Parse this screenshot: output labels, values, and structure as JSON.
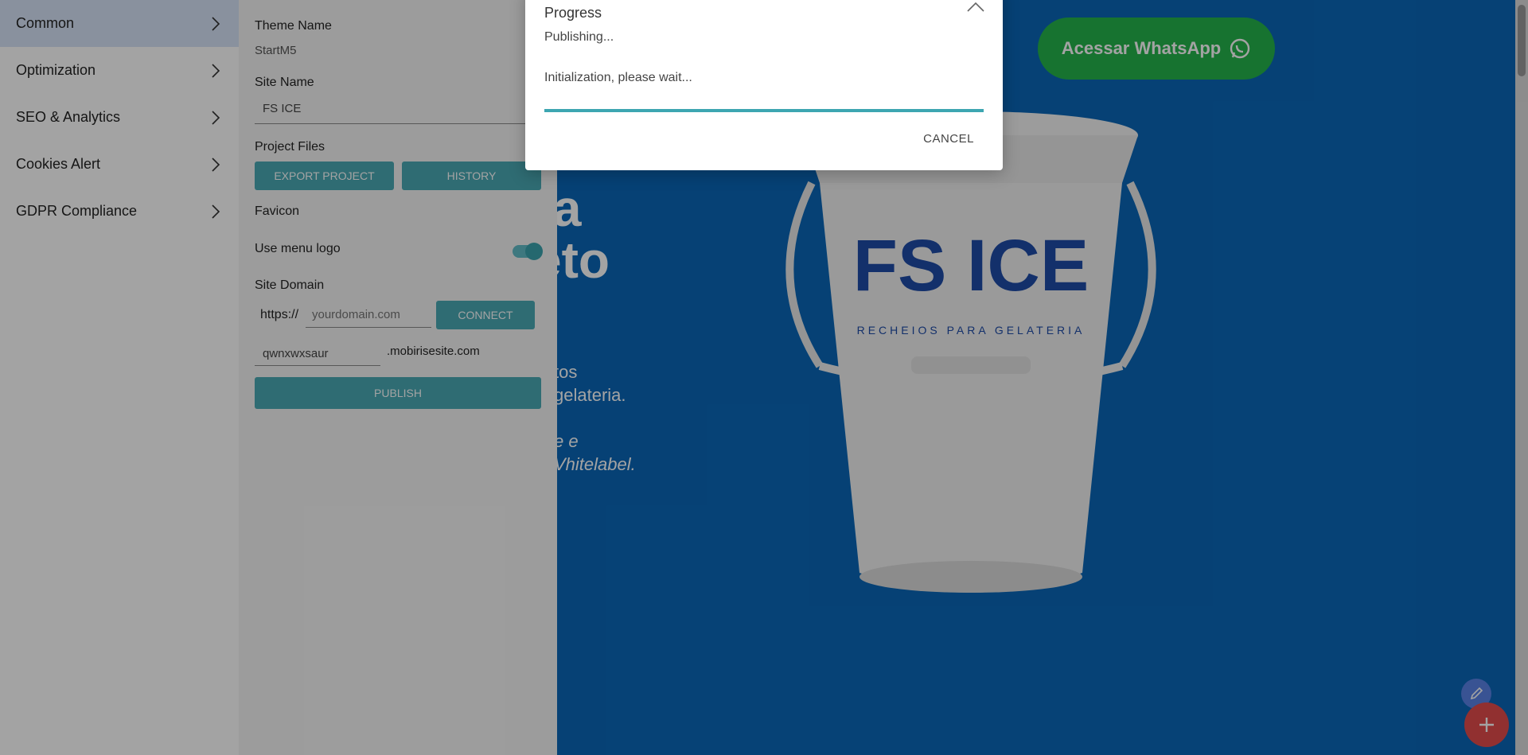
{
  "sidebar": {
    "items": [
      {
        "label": "Common"
      },
      {
        "label": "Optimization"
      },
      {
        "label": "SEO & Analytics"
      },
      {
        "label": "Cookies Alert"
      },
      {
        "label": "GDPR Compliance"
      }
    ]
  },
  "settings": {
    "theme_name_label": "Theme Name",
    "theme_name_value": "StartM5",
    "site_name_label": "Site Name",
    "site_name_value": "FS ICE",
    "project_files_label": "Project Files",
    "export_label": "EXPORT PROJECT",
    "history_label": "HISTORY",
    "favicon_label": "Favicon",
    "menu_logo_label": "Use menu logo",
    "menu_logo_on": true,
    "site_domain_label": "Site Domain",
    "https_prefix": "https://",
    "domain_placeholder": "yourdomain.com",
    "connect_label": "CONNECT",
    "subdomain_value": "qwnxwxsaur",
    "subdomain_suffix": ".mobirisesite.com",
    "publish_label": "PUBLISH"
  },
  "preview": {
    "whatsapp_label": "Acessar WhatsApp",
    "hero_line1": "ra",
    "hero_line2": "eto",
    "sub_line1": "tos",
    "sub_line2": "gelateria.",
    "sub_line3": "e e",
    "sub_line4": "Vhitelabel.",
    "bucket_brand": "FS ICE",
    "bucket_tagline": "RECHEIOS PARA GELATERIA"
  },
  "dialog": {
    "title": "Progress",
    "publishing": "Publishing...",
    "init": "Initialization, please wait...",
    "cancel_label": "CANCEL"
  },
  "colors": {
    "accent": "#4aa9b4",
    "preview_bg": "#0a67b8",
    "whatsapp": "#25b44c",
    "fab_add": "#e34b4b",
    "fab_edit": "#5a82e6"
  }
}
